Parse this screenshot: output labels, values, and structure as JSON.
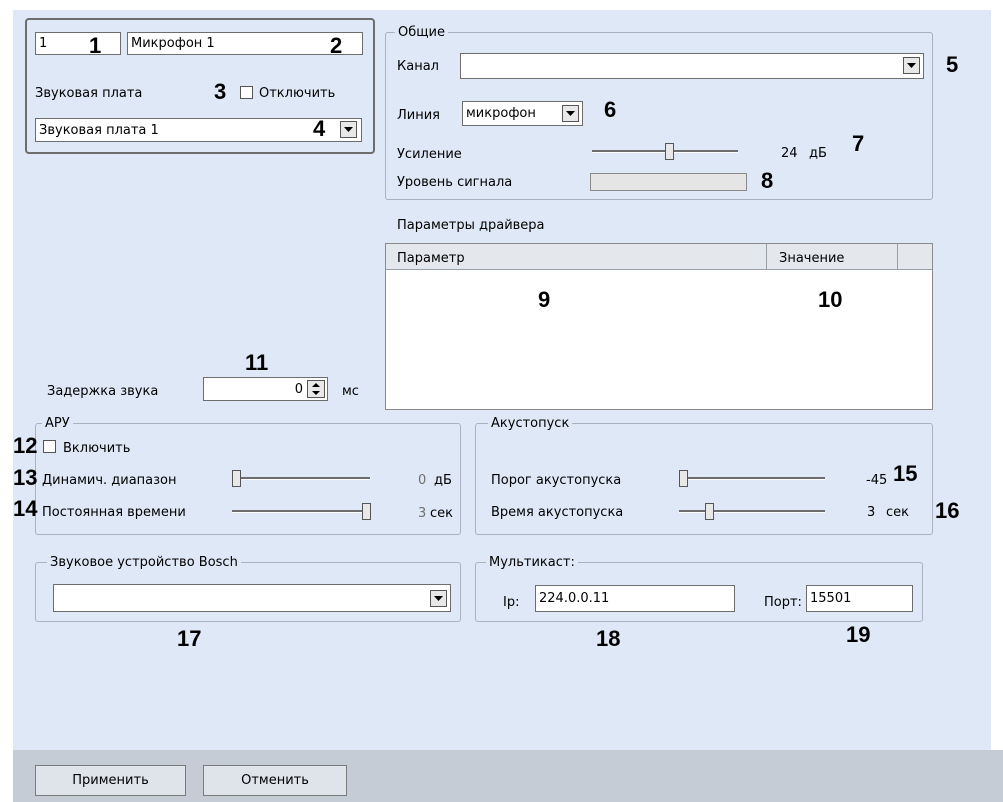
{
  "device": {
    "id": "1",
    "name": "Микрофон 1",
    "sound_card_label": "Звуковая плата",
    "disable_label": "Отключить",
    "disable_checked": false,
    "sound_card_value": "Звуковая плата 1"
  },
  "general": {
    "title": "Общие",
    "channel_label": "Канал",
    "channel_value": "",
    "line_label": "Линия",
    "line_value": "микрофон",
    "gain_label": "Усиление",
    "gain_value": "24",
    "gain_unit": "дБ",
    "signal_label": "Уровень сигнала"
  },
  "driver": {
    "title": "Параметры драйвера",
    "col_param": "Параметр",
    "col_value": "Значение"
  },
  "delay": {
    "label": "Задержка звука",
    "value": "0",
    "unit": "мс"
  },
  "agc": {
    "title": "АРУ",
    "enable_label": "Включить",
    "enable_checked": false,
    "range_label": "Динамич. диапазон",
    "range_value": "0",
    "range_unit": "дБ",
    "time_label": "Постоянная времени",
    "time_value": "3",
    "time_unit": "сек"
  },
  "vox": {
    "title": "Акустопуск",
    "threshold_label": "Порог акустопуска",
    "threshold_value": "-45",
    "time_label": "Время акустопуска",
    "time_value": "3",
    "time_unit": "сек"
  },
  "bosch": {
    "title": "Звуковое устройство Bosch",
    "value": ""
  },
  "multicast": {
    "title": "Мультикаст:",
    "ip_label": "Ip:",
    "ip_value": "224.0.0.11",
    "port_label": "Порт:",
    "port_value": "15501"
  },
  "buttons": {
    "apply": "Применить",
    "cancel": "Отменить"
  },
  "callouts": [
    "1",
    "2",
    "3",
    "4",
    "5",
    "6",
    "7",
    "8",
    "9",
    "10",
    "11",
    "12",
    "13",
    "14",
    "15",
    "16",
    "17",
    "18",
    "19"
  ]
}
